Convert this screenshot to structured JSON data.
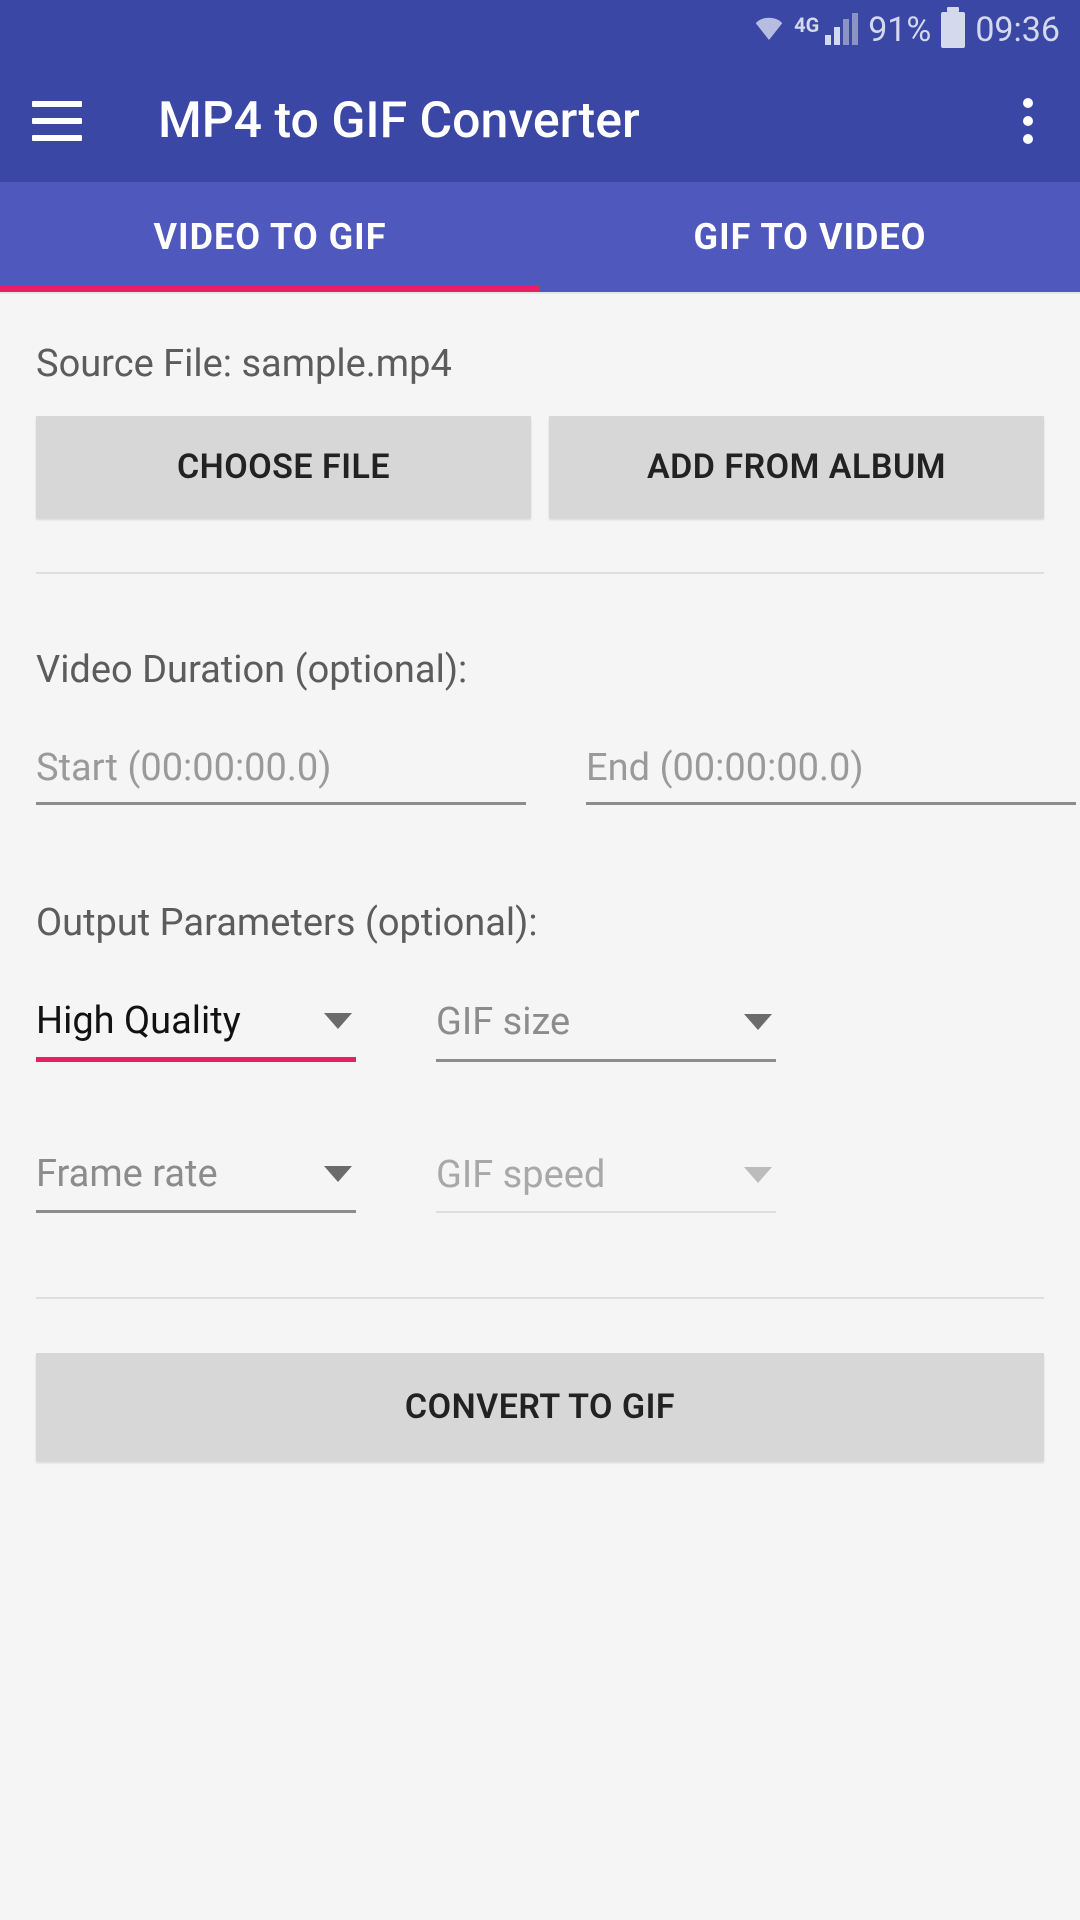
{
  "status_bar": {
    "network_type": "4G",
    "battery_percent": "91%",
    "time": "09:36"
  },
  "app_bar": {
    "title": "MP4 to GIF Converter"
  },
  "tabs": {
    "video_to_gif": "VIDEO TO GIF",
    "gif_to_video": "GIF TO VIDEO",
    "active_index": 0
  },
  "source": {
    "label": "Source File: sample.mp4",
    "choose_file": "CHOOSE FILE",
    "add_from_album": "ADD FROM ALBUM"
  },
  "duration": {
    "label": "Video Duration (optional):",
    "start_placeholder": "Start (00:00:00.0)",
    "end_placeholder": "End (00:00:00.0)",
    "start_value": "",
    "end_value": ""
  },
  "output": {
    "label": "Output Parameters (optional):",
    "quality_selected": "High Quality",
    "gif_size_placeholder": "GIF size",
    "frame_rate_placeholder": "Frame rate",
    "gif_speed_placeholder": "GIF speed"
  },
  "convert": {
    "label": "CONVERT TO GIF"
  }
}
